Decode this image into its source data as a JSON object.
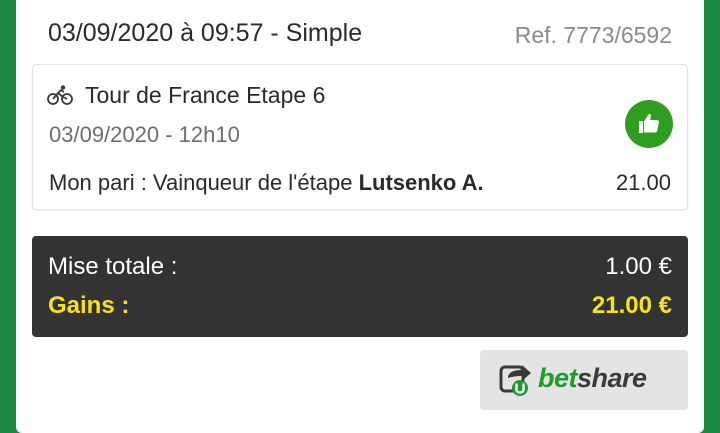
{
  "colors": {
    "background_green": "#1c8a44",
    "summary_bg": "#333333",
    "gains_yellow": "#f7e11f",
    "thumb_green": "#2e9e1f",
    "betshare_green": "#1f9a2c"
  },
  "header": {
    "datetime_type": "03/09/2020 à 09:57 - Simple",
    "reference": "Ref. 7773/6592"
  },
  "bet": {
    "icon": "cycling-icon",
    "event_name": "Tour de France Etape 6",
    "event_date": "03/09/2020 - 12h10",
    "status_icon": "thumbs-up-icon",
    "pick_prefix": "Mon pari : Vainqueur de l'étape",
    "pick_selection": "Lutsenko A.",
    "odds": "21.00"
  },
  "summary": {
    "stake_label": "Mise totale :",
    "stake_value": "1.00 €",
    "gains_label": "Gains :",
    "gains_value": "21.00 €"
  },
  "betshare": {
    "icon": "share-arrow-icon",
    "text_bet": "bet",
    "text_share": "share"
  }
}
